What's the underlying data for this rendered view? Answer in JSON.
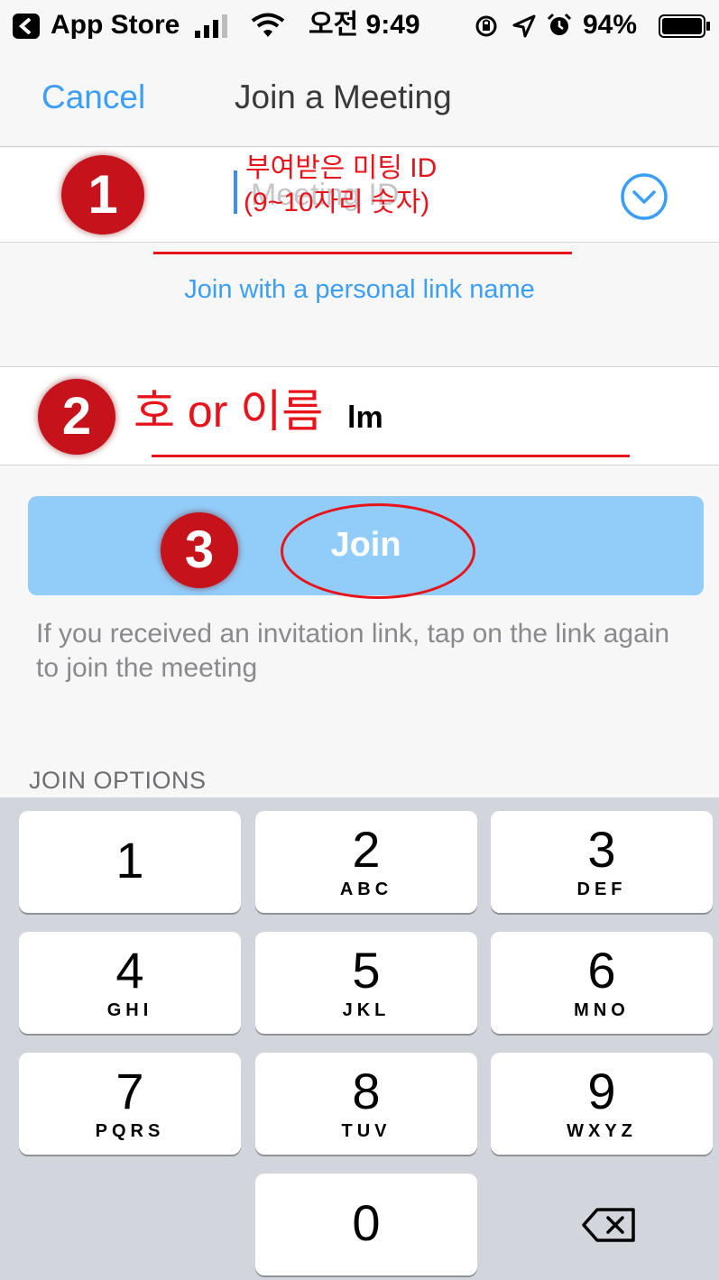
{
  "status_bar": {
    "back_app": "App Store",
    "time": "오전 9:49",
    "battery": "94%"
  },
  "nav": {
    "cancel_label": "Cancel",
    "title": "Join a Meeting"
  },
  "meeting_id": {
    "placeholder": "Meeting ID",
    "value": ""
  },
  "personal_link_label": "Join with a personal link name",
  "name": {
    "value": "lm"
  },
  "join_button_label": "Join",
  "invite_hint": "If you received an invitation link, tap on the link again to join the meeting",
  "join_options_header": "JOIN OPTIONS",
  "keypad": {
    "keys": [
      {
        "digit": "1",
        "letters": ""
      },
      {
        "digit": "2",
        "letters": "ABC"
      },
      {
        "digit": "3",
        "letters": "DEF"
      },
      {
        "digit": "4",
        "letters": "GHI"
      },
      {
        "digit": "5",
        "letters": "JKL"
      },
      {
        "digit": "6",
        "letters": "MNO"
      },
      {
        "digit": "7",
        "letters": "PQRS"
      },
      {
        "digit": "8",
        "letters": "TUV"
      },
      {
        "digit": "9",
        "letters": "WXYZ"
      },
      {
        "digit": "0",
        "letters": ""
      }
    ]
  },
  "annotations": {
    "step1_number": "1",
    "step1_line1": "부여받은 미팅 ID",
    "step1_line2": "(9~10자리 숫자)",
    "step2_number": "2",
    "step2_text": "호 or 이름",
    "step3_number": "3",
    "annotation_color": "#e8141c",
    "badge_color": "#c5121b"
  },
  "colors": {
    "accent": "#3b9ef7",
    "join_button": "#92cdf9",
    "keypad_bg": "#d2d5db"
  }
}
